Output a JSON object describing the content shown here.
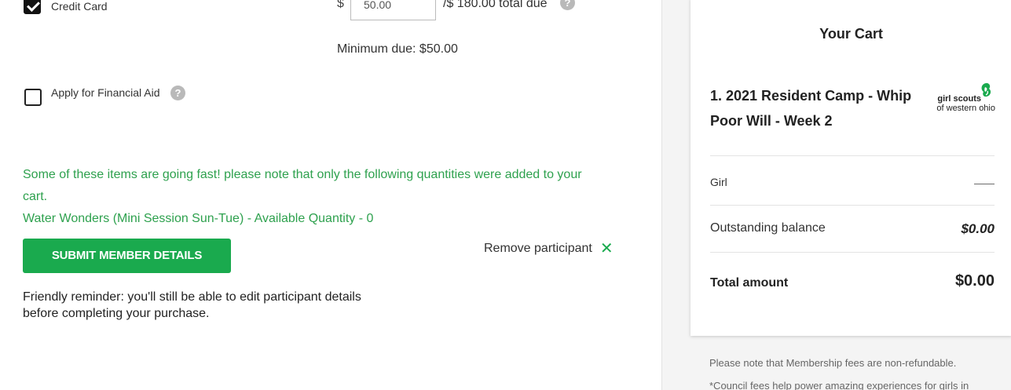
{
  "payment": {
    "credit_card_label": "Credit Card",
    "credit_card_checked": true,
    "currency_symbol": "$",
    "amount_value": "50.00",
    "total_due_text": "/$ 180.00 total due",
    "minimum_due_text": "Minimum due: $50.00"
  },
  "financial_aid": {
    "label": "Apply for Financial Aid",
    "checked": false,
    "help_glyph": "?"
  },
  "notice": {
    "line1": "Some of these items are going fast! please note that only the following quantities were added to your",
    "line2": "cart.",
    "line3": "Water Wonders (Mini Session Sun-Tue) - Available Quantity - 0",
    "color": "#2ea14e"
  },
  "actions": {
    "submit_label": "SUBMIT MEMBER DETAILS",
    "remove_participant_label": "Remove participant",
    "close_glyph": "✕",
    "accent_color": "#1aaa4e"
  },
  "reminder": {
    "line1": "Friendly reminder: you'll still be able to edit participant details",
    "line2": "before completing your purchase."
  },
  "cart": {
    "title": "Your Cart",
    "item_name_line1": "1. 2021 Resident Camp - Whip",
    "item_name_line2": "Poor Will - Week 2",
    "logo_main": "girl scouts",
    "logo_sub": "of western ohio",
    "participant_label": "Girl",
    "participant_value": "——",
    "outstanding_label": "Outstanding balance",
    "outstanding_value": "$0.00",
    "total_label": "Total amount",
    "total_value": "$0.00"
  },
  "side_notes": {
    "note1": "Please note that Membership fees are non-refundable.",
    "note2": "*Council fees help power amazing experiences for girls in"
  },
  "icons": {
    "help": "help-icon",
    "close": "close-icon",
    "logo": "girl-scouts-trefoil-icon"
  }
}
